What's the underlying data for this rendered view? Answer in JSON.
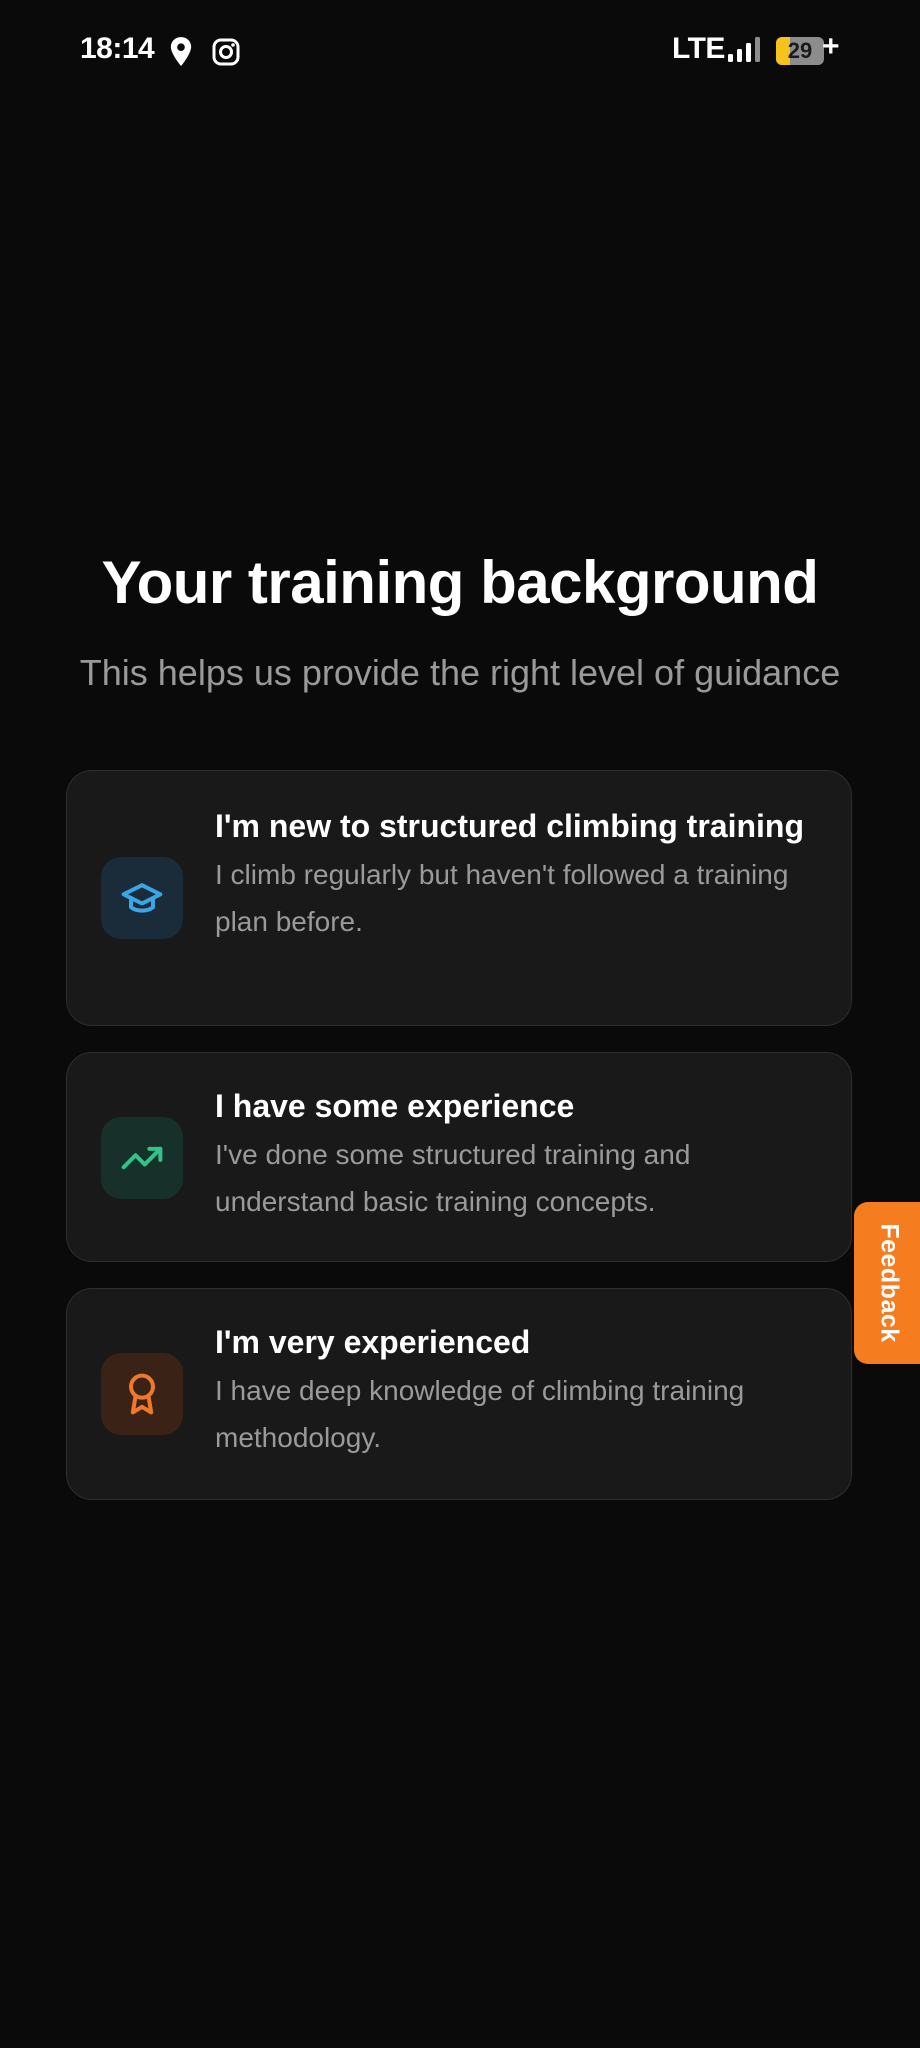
{
  "status_bar": {
    "time": "18:14",
    "network": "LTE",
    "battery_level": "29",
    "battery_percent": 29,
    "charging_symbol": "+",
    "icons": [
      "location-icon",
      "instagram-icon",
      "signal-icon",
      "battery-icon"
    ]
  },
  "header": {
    "title": "Your training background",
    "subtitle": "This helps us provide the right level of guidance"
  },
  "options": [
    {
      "title": "I'm new to structured climbing training",
      "description": "I climb regularly but haven't followed a training plan before.",
      "icon": "graduation-cap-icon",
      "accent_color": "#3ba6e6"
    },
    {
      "title": "I have some experience",
      "description": "I've done some structured training and understand basic training concepts.",
      "icon": "trending-up-icon",
      "accent_color": "#33c28a"
    },
    {
      "title": "I'm very experienced",
      "description": "I have deep knowledge of climbing training methodology.",
      "icon": "award-icon",
      "accent_color": "#f0782a"
    }
  ],
  "feedback": {
    "label": "Feedback",
    "color": "#f57c1f"
  },
  "colors": {
    "background": "#0a0a0a",
    "card_background": "#191919",
    "card_border": "#2e2e2e",
    "secondary_text": "#9a9a9a"
  }
}
